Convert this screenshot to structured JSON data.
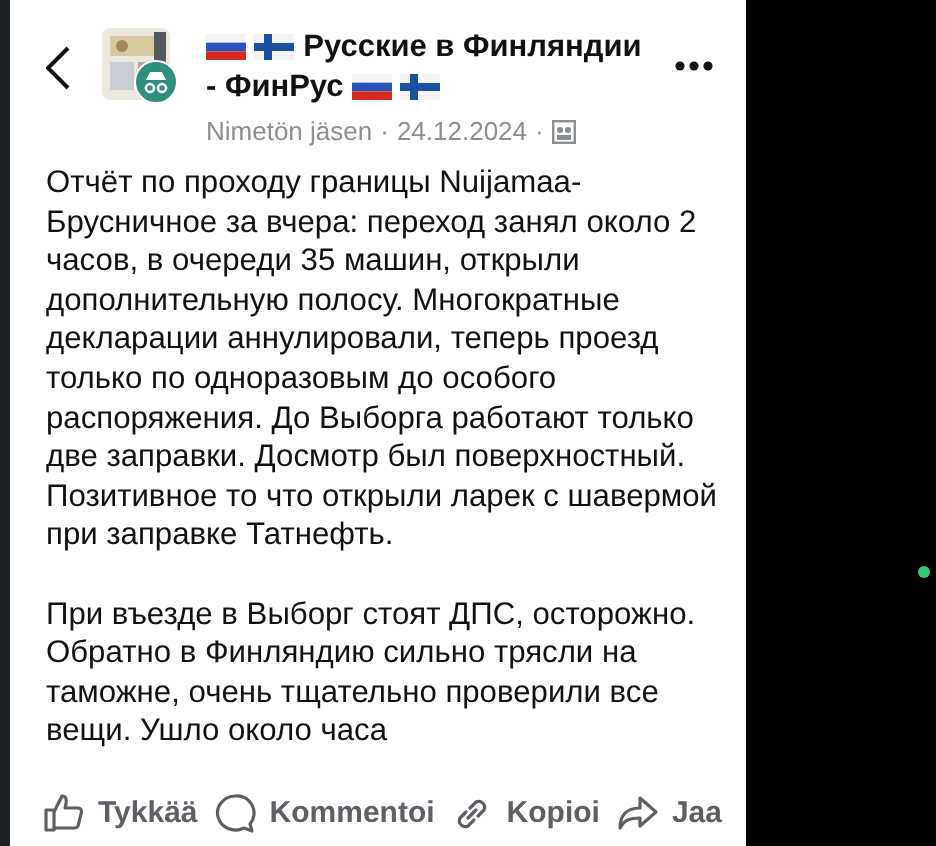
{
  "post": {
    "group_title_part_1": "Русские в Финляндии",
    "group_title_part_2": "- ФинРус",
    "author": "Nimetön jäsen",
    "separator_1": "·",
    "date": "24.12.2024",
    "separator_2": "·",
    "paragraphs": [
      "Отчёт по проходу границы Nuijamaa-Брусничное за вчера: переход занял около 2 часов, в очереди 35 машин, открыли дополнительную полосу. Многократные декларации аннулировали, теперь проезд только по одноразовым до особого распоряжения. До Выборга работают только две заправки. Досмотр был поверхностный. Позитивное то что открыли ларек с шавермой при заправке Татнефть.",
      "При въезде в Выборг стоят ДПС, осторожно. Обратно в Финляндию сильно трясли на таможне, очень тщательно проверили все вещи. Ушло около часа"
    ]
  },
  "actions": [
    {
      "kind": "like",
      "label": "Tykkää"
    },
    {
      "kind": "comment",
      "label": "Kommentoi"
    },
    {
      "kind": "copy",
      "label": "Kopioi"
    },
    {
      "kind": "share",
      "label": "Jaa"
    }
  ]
}
